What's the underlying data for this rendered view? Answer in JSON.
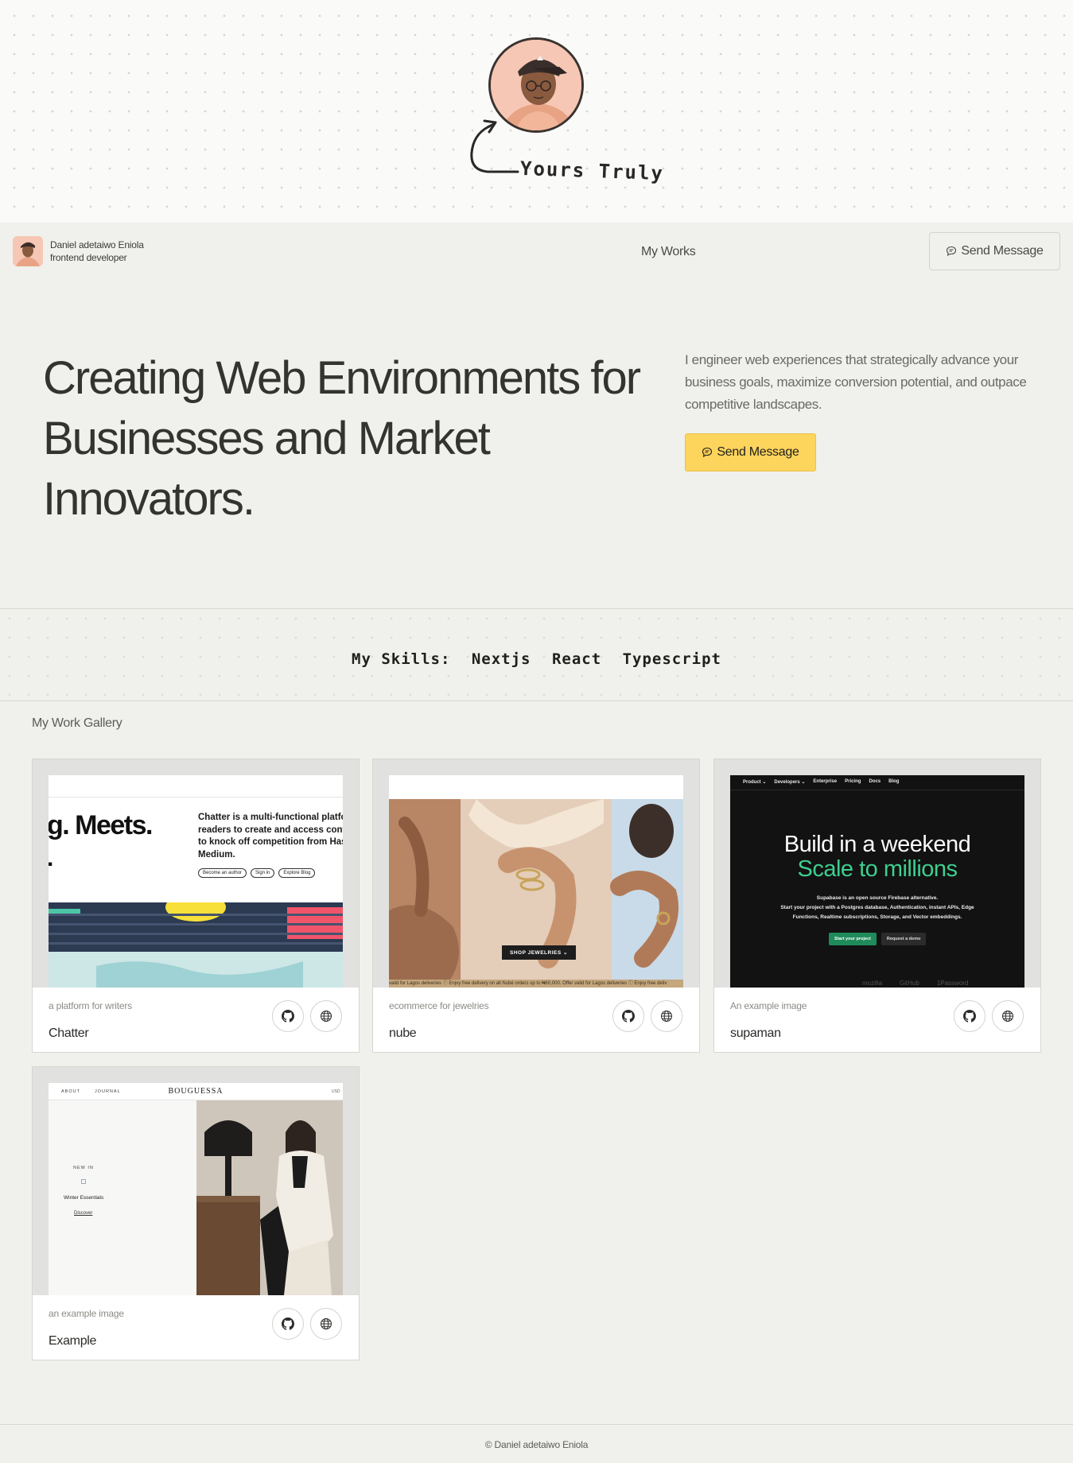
{
  "top": {
    "caption": "Yours Truly"
  },
  "header": {
    "name": "Daniel adetaiwo Eniola",
    "role": "frontend developer",
    "nav_works": "My Works",
    "send_message": "Send Message"
  },
  "hero": {
    "title_line1": "Creating Web Environments for",
    "title_line2": "Businesses and Market",
    "title_line3": "Innovators.",
    "description": "I engineer web experiences that strategically advance your business goals, maximize conversion potential, and outpace competitive landscapes.",
    "cta": "Send Message"
  },
  "skills": {
    "label": "My Skills:",
    "items": [
      "Nextjs",
      "React",
      "Typescript"
    ]
  },
  "gallery": {
    "title": "My Work Gallery",
    "cards": [
      {
        "subtitle": "a platform for writers",
        "title": "Chatter",
        "shot": {
          "headline": "g. Meets.",
          "headline_tail": ".",
          "text_l1": "Chatter is a multi-functional platfor",
          "text_l2": "readers to create and access conte",
          "text_l3": "to knock off competition from Hash",
          "text_l4": "Medium.",
          "pill1": "Become an author",
          "pill2": "Sign in",
          "pill3": "Explore Blog"
        }
      },
      {
        "subtitle": "ecommerce for jewelries",
        "title": "nube",
        "shot": {
          "button": "SHOP JEWELRIES ⌄",
          "ticker": "valid for Lagos deliveries  ⓘ Enjoy free delivery on all Nubé orders up to ₦60,000. Offer valid for Lagos deliveries  ⓘ Enjoy free deliv"
        }
      },
      {
        "subtitle": "An example image",
        "title": "supaman",
        "shot": {
          "nav": [
            "Product ⌄",
            "Developers ⌄",
            "Enterprise",
            "Pricing",
            "Docs",
            "Blog"
          ],
          "headline1": "Build in a weekend",
          "headline2": "Scale to millions",
          "sub1": "Supabase is an open source Firebase alternative.",
          "sub2": "Start your project with a Postgres database, Authentication, instant APIs, Edge",
          "sub3": "Functions, Realtime subscriptions, Storage, and Vector embeddings.",
          "btn_primary": "Start your project",
          "btn_secondary": "Request a demo",
          "logos": [
            "mozilla",
            "GitHub",
            "1Password"
          ]
        }
      },
      {
        "subtitle": "an example image",
        "title": "Example",
        "shot": {
          "nav_about": "ABOUT",
          "nav_journal": "JOURNAL",
          "brand": "BOUGUESSA",
          "currency": "USD",
          "new_in": "NEW IN",
          "collection": "Winter Essentials",
          "discover": "Discover"
        }
      }
    ]
  },
  "footer": {
    "text": "© Daniel adetaiwo Eniola"
  },
  "colors": {
    "page_bg": "#f0f1ec",
    "cta_yellow": "#fdd45c",
    "supabase_green": "#3ecf8e"
  },
  "icons": [
    "message-icon",
    "github-icon",
    "globe-icon",
    "curved-arrow-icon"
  ]
}
